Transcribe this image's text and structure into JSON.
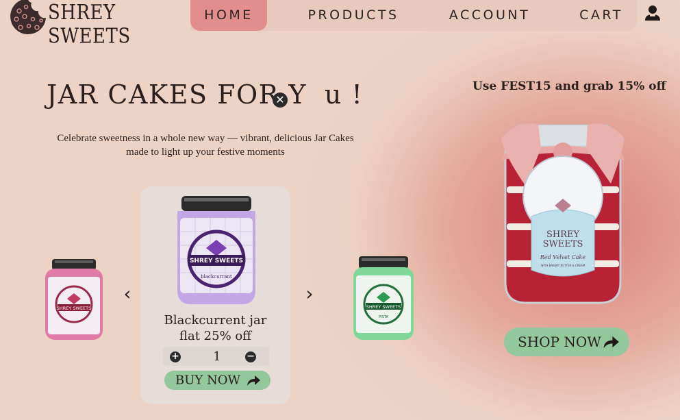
{
  "brand": {
    "name": "SHREY SWEETS"
  },
  "nav": {
    "items": [
      {
        "label": "HOME",
        "active": true
      },
      {
        "label": "PRODUCTS",
        "active": false
      },
      {
        "label": "ACCOUNT",
        "active": false
      },
      {
        "label": "CART",
        "active": false
      }
    ],
    "user_icon": "user-icon"
  },
  "hero": {
    "title_part1": "JAR CAKES FOR Y",
    "title_part2": "u !",
    "close_glyph": "✕",
    "subtitle_line1": "Celebrate sweetness in a whole new way — vibrant, delicious  Jar Cakes",
    "subtitle_line2": "made to light up your festive moments"
  },
  "promo": {
    "text": "Use FEST15 and  grab 15% off"
  },
  "carousel": {
    "prev_label": "‹",
    "next_label": "›",
    "left_jar": {
      "brand": "SHREY SWEETS",
      "color": "#e07aa6"
    },
    "right_jar": {
      "brand": "SHREY SWEETS",
      "flavour": "PISTA",
      "color": "#7fd89a"
    },
    "current": {
      "brand": "SHREY SWEETS",
      "flavour": "blackcurrant",
      "title_line1": "Blackcurrent jar",
      "title_line2": "flat 25% off",
      "quantity": "1",
      "plus": "+",
      "minus": "−",
      "buy_label": "BUY NOW",
      "color": "#b58be0"
    }
  },
  "featured": {
    "brand_line1": "SHREY",
    "brand_line2": "SWEETS",
    "product": "Red Velvet Cake",
    "tagline": "WITH BAKERY BUTTER & CREAM",
    "shop_label": "SHOP NOW"
  },
  "colors": {
    "background": "#ecd3c6",
    "nav_bg": "#e7c9bd",
    "nav_active": "#e28e8e",
    "button": "#93c79c",
    "card": "#e6dcd8"
  }
}
